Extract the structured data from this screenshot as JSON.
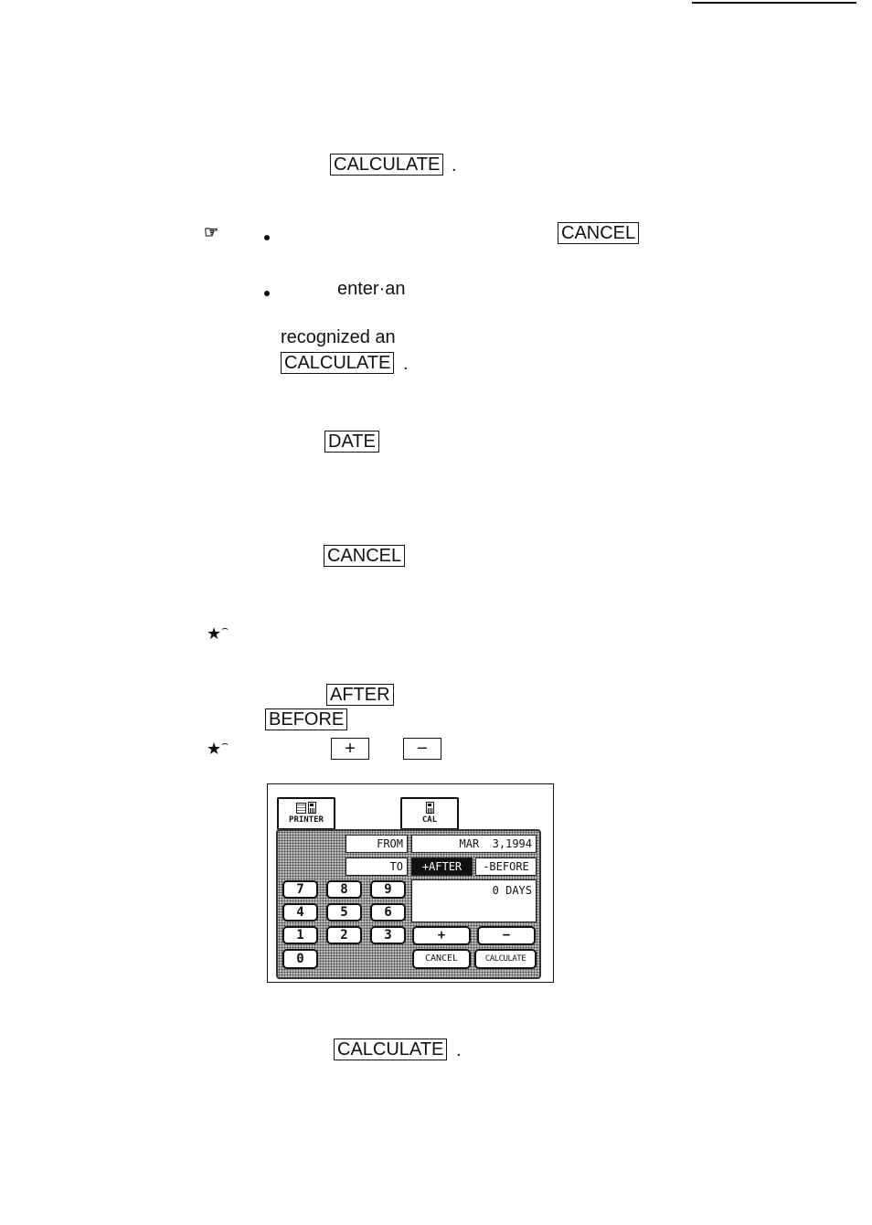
{
  "page": {
    "step_calculate_1": "CALCULATE",
    "note_cancel": "CANCEL",
    "note_text_enter": "enter·an",
    "note_text_recognized": "recognized an",
    "note_calculate": "CALCULATE",
    "date_button": "DATE",
    "cancel_button": "CANCEL",
    "after_button": "AFTER",
    "before_button": "BEFORE",
    "plus_button": "+",
    "minus_button": "−",
    "step_calculate_2": "CALCULATE",
    "period": ".",
    "note_icon": "☞",
    "star_icon": "★"
  },
  "screen": {
    "printer_label": "PRINTER",
    "cal_label": "CAL",
    "from_label": "FROM",
    "to_label": "TO",
    "date_value": "MAR  3,1994",
    "after_label": "+AFTER",
    "before_label": "-BEFORE",
    "days_value": "0 DAYS",
    "keys": [
      "7",
      "8",
      "9",
      "4",
      "5",
      "6",
      "1",
      "2",
      "3",
      "0"
    ],
    "plus_label": "+",
    "minus_label": "−",
    "cancel_label": "CANCEL",
    "calculate_label": "CALCULATE"
  }
}
